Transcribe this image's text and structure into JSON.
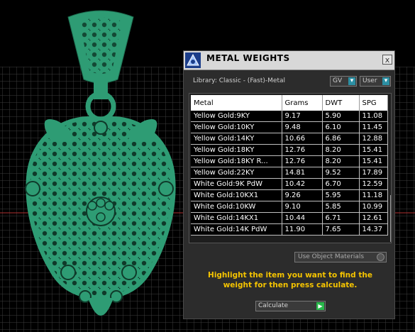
{
  "dialog": {
    "title": "METAL WEIGHTS",
    "close_label": "x",
    "library_label": "Library: Classic - (Fast)-Metal",
    "gv_select": "GV",
    "user_select": "User",
    "columns": [
      "Metal",
      "Grams",
      "DWT",
      "SPG"
    ],
    "rows": [
      [
        "Yellow Gold:9KY",
        "9.17",
        "5.90",
        "11.08"
      ],
      [
        "Yellow Gold:10KY",
        "9.48",
        "6.10",
        "11.45"
      ],
      [
        "Yellow Gold:14KY",
        "10.66",
        "6.86",
        "12.88"
      ],
      [
        "Yellow Gold:18KY",
        "12.76",
        "8.20",
        "15.41"
      ],
      [
        "Yellow Gold:18KY R...",
        "12.76",
        "8.20",
        "15.41"
      ],
      [
        "Yellow Gold:22KY",
        "14.81",
        "9.52",
        "17.89"
      ],
      [
        "White Gold:9K PdW",
        "10.42",
        "6.70",
        "12.59"
      ],
      [
        "White Gold:10KX1",
        "9.26",
        "5.95",
        "11.18"
      ],
      [
        "White Gold:10KW",
        "9.10",
        "5.85",
        "10.99"
      ],
      [
        "White Gold:14KX1",
        "10.44",
        "6.71",
        "12.61"
      ],
      [
        "White Gold:14K PdW",
        "11.90",
        "7.65",
        "14.37"
      ]
    ],
    "use_object_materials": "Use Object Materials",
    "hint_text": "Highlight the item you want to find the weight for then press calculate.",
    "calculate_label": "Calculate"
  },
  "colors": {
    "pendant": "#2e9c74",
    "grid": "#3c3c3c",
    "hint": "#f5c400",
    "accent": "#2c8fa3",
    "go": "#29b84b"
  },
  "icons": [
    "app-icon",
    "close-icon",
    "chevron-down-icon",
    "play-icon"
  ]
}
